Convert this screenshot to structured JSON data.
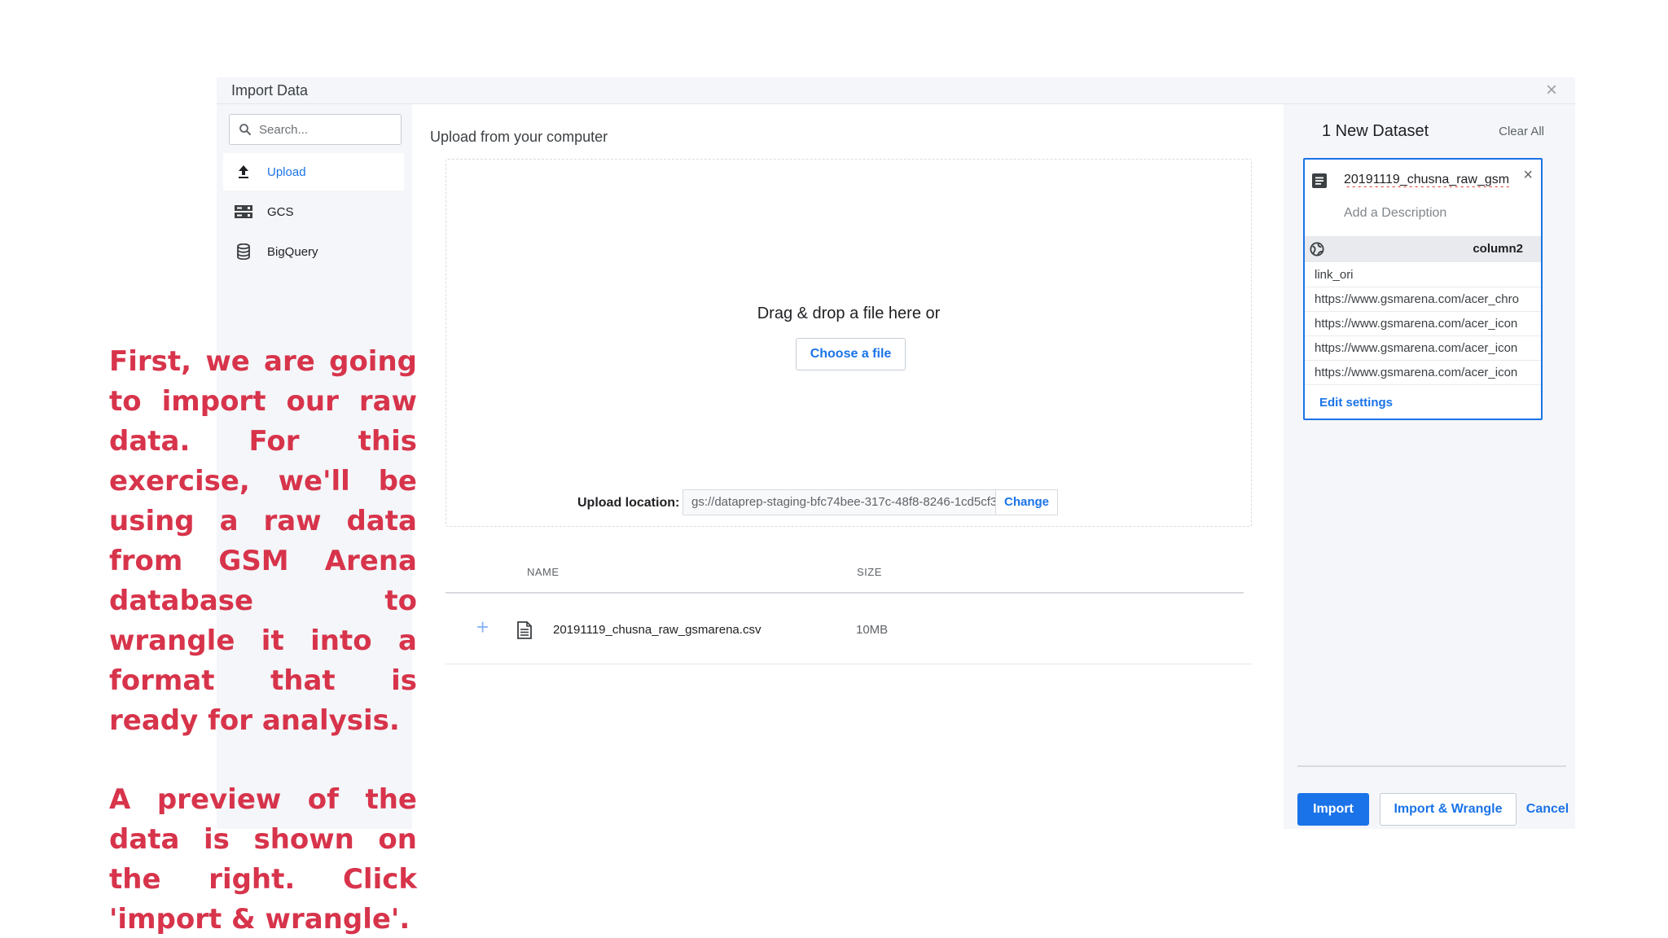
{
  "dialog": {
    "title": "Import Data",
    "close_symbol": "×"
  },
  "sidebar": {
    "search_placeholder": "Search...",
    "items": [
      {
        "label": "Upload",
        "icon": "upload-icon",
        "active": true
      },
      {
        "label": "GCS",
        "icon": "gcs-storage-icon",
        "active": false
      },
      {
        "label": "BigQuery",
        "icon": "database-icon",
        "active": false
      }
    ]
  },
  "main": {
    "section_title": "Upload from your computer",
    "drop_text": "Drag & drop a file here or",
    "choose_button": "Choose a file",
    "upload_location_label": "Upload location:",
    "upload_location_value": "gs://dataprep-staging-bfc74bee-317c-48f8-8246-1cd5cf3...",
    "change_button": "Change",
    "table": {
      "headers": [
        "NAME",
        "SIZE"
      ],
      "rows": [
        {
          "plus": "+",
          "name": "20191119_chusna_raw_gsmarena.csv",
          "size": "10MB"
        }
      ]
    }
  },
  "right_panel": {
    "title": "1 New Dataset",
    "clear_all": "Clear All",
    "dataset": {
      "name": "20191119_chusna_raw_gsm",
      "description_placeholder": "Add a Description",
      "close_symbol": "×",
      "column_header": "column2",
      "preview_rows": [
        "link_ori",
        "https://www.gsmarena.com/acer_chro",
        "https://www.gsmarena.com/acer_icon",
        "https://www.gsmarena.com/acer_icon",
        "https://www.gsmarena.com/acer_icon"
      ],
      "edit_settings": "Edit settings"
    },
    "buttons": {
      "import": "Import",
      "import_wrangle": "Import & Wrangle",
      "cancel": "Cancel"
    }
  },
  "annotation": {
    "paragraph1": "First, we are going to import our raw data. For this exercise, we'll be using a raw data from GSM Arena database to wrangle it into a format that is ready for analysis.",
    "paragraph2": "A preview of the data is shown on the right. Click 'import & wrangle'.",
    "color": "#d7344b"
  },
  "colors": {
    "accent": "#1a73e8",
    "panel_bg": "#f4f6f9"
  }
}
